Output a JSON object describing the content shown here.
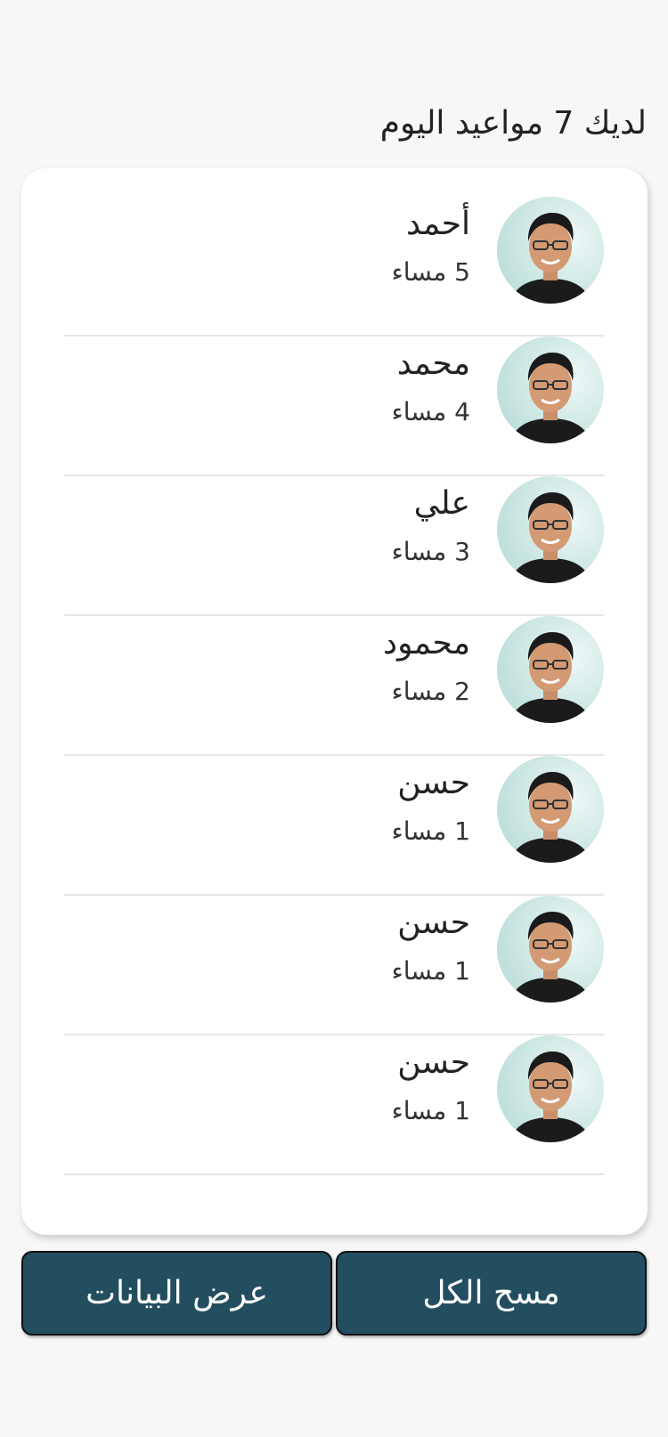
{
  "header": {
    "title": "لديك 7 مواعيد اليوم"
  },
  "appointments": [
    {
      "name": "أحمد",
      "time": "5 مساء"
    },
    {
      "name": "محمد",
      "time": "4 مساء"
    },
    {
      "name": "علي",
      "time": "3 مساء"
    },
    {
      "name": "محمود",
      "time": "2 مساء"
    },
    {
      "name": "حسن",
      "time": "1 مساء"
    },
    {
      "name": "حسن",
      "time": "1 مساء"
    },
    {
      "name": "حسن",
      "time": "1 مساء"
    }
  ],
  "actions": {
    "view_data_label": "عرض البيانات",
    "clear_all_label": "مسح الكل"
  },
  "colors": {
    "button_bg": "#234e60",
    "page_bg": "#f7f7f7",
    "card_bg": "#ffffff"
  }
}
